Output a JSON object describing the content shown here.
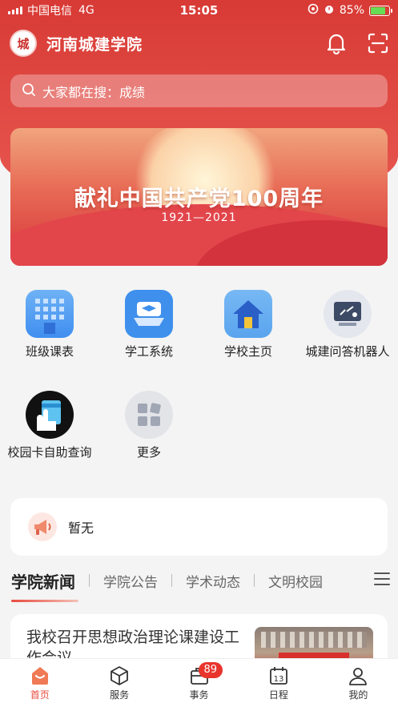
{
  "status_bar": {
    "carrier": "中国电信",
    "network": "4G",
    "time": "15:05",
    "battery": "85%",
    "battery_level": 0.85
  },
  "header": {
    "logo_text": "城",
    "title": "河南城建学院"
  },
  "search": {
    "placeholder": "大家都在搜：成绩"
  },
  "banner": {
    "title": "献礼中国共产党100周年",
    "years": "1921—2021"
  },
  "grid": [
    {
      "label": "班级课表",
      "icon": "timetable-icon"
    },
    {
      "label": "学工系统",
      "icon": "graduation-cap-icon"
    },
    {
      "label": "学校主页",
      "icon": "home-icon"
    },
    {
      "label": "城建问答机器人",
      "icon": "chatbot-icon"
    },
    {
      "label": "校园卡自助查询",
      "icon": "campus-card-icon"
    },
    {
      "label": "更多",
      "icon": "more-apps-icon"
    }
  ],
  "notice": {
    "text": "暂无"
  },
  "news_tabs": [
    "学院新闻",
    "学院公告",
    "学术动态",
    "文明校园"
  ],
  "news": [
    {
      "title": "我校召开思想政治理论课建设工作会议"
    }
  ],
  "tabbar": [
    {
      "label": "首页",
      "icon": "home-tab-icon",
      "active": true
    },
    {
      "label": "服务",
      "icon": "cube-icon",
      "active": false
    },
    {
      "label": "事务",
      "icon": "briefcase-icon",
      "active": false,
      "badge": "89"
    },
    {
      "label": "日程",
      "icon": "calendar-icon",
      "active": false,
      "calendar_day": "13"
    },
    {
      "label": "我的",
      "icon": "user-icon",
      "active": false
    }
  ],
  "colors": {
    "brand_red": "#d83a35",
    "accent": "#e84a3e"
  }
}
